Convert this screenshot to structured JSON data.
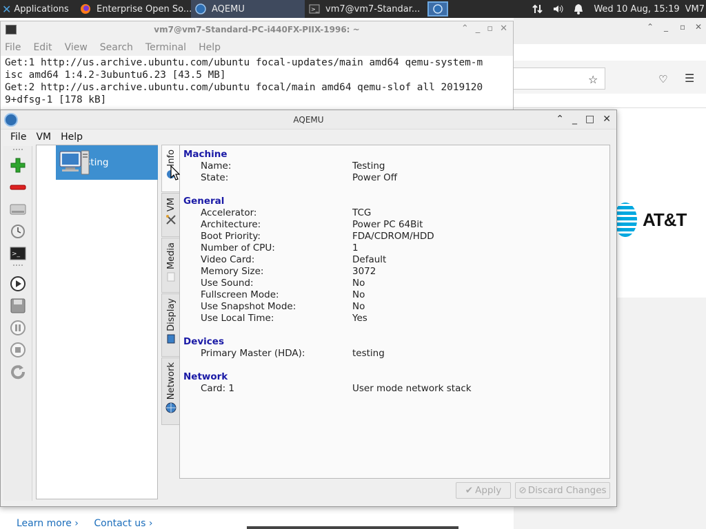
{
  "taskbar": {
    "applications": "Applications",
    "tasks": [
      {
        "label": "Enterprise Open So..."
      },
      {
        "label": "AQEMU"
      },
      {
        "label": "vm7@vm7-Standar..."
      }
    ],
    "clock": "Wed 10 Aug, 15:19",
    "user": "VM7"
  },
  "terminal": {
    "title": "vm7@vm7-Standard-PC-i440FX-PIIX-1996: ~",
    "menu": [
      "File",
      "Edit",
      "View",
      "Search",
      "Terminal",
      "Help"
    ],
    "lines": [
      "Get:1 http://us.archive.ubuntu.com/ubuntu focal-updates/main amd64 qemu-system-m",
      "isc amd64 1:4.2-3ubuntu6.23 [43.5 MB]",
      "Get:2 http://us.archive.ubuntu.com/ubuntu focal/main amd64 qemu-slof all 2019120",
      "9+dfsg-1 [178 kB]"
    ]
  },
  "browser": {
    "brand": "AT&T",
    "links": [
      "Learn more ›",
      "Contact us ›"
    ]
  },
  "aqemu": {
    "title": "AQEMU",
    "menu": [
      "File",
      "VM",
      "Help"
    ],
    "vm_name": "Testing",
    "tabs": [
      "Info",
      "VM",
      "Media",
      "Display",
      "Network"
    ],
    "sections": {
      "machine": {
        "heading": "Machine",
        "rows": [
          {
            "k": "Name:",
            "v": "Testing"
          },
          {
            "k": "State:",
            "v": "Power Off"
          }
        ]
      },
      "general": {
        "heading": "General",
        "rows": [
          {
            "k": "Accelerator:",
            "v": "TCG"
          },
          {
            "k": "Architecture:",
            "v": "Power PC 64Bit"
          },
          {
            "k": "Boot Priority:",
            "v": "FDA/CDROM/HDD"
          },
          {
            "k": "Number of CPU:",
            "v": "1"
          },
          {
            "k": "Video Card:",
            "v": "Default"
          },
          {
            "k": "Memory Size:",
            "v": "3072"
          },
          {
            "k": "Use Sound:",
            "v": "No"
          },
          {
            "k": "Fullscreen Mode:",
            "v": "No"
          },
          {
            "k": "Use Snapshot Mode:",
            "v": "No"
          },
          {
            "k": "Use Local Time:",
            "v": "Yes"
          }
        ]
      },
      "devices": {
        "heading": "Devices",
        "rows": [
          {
            "k": "Primary Master (HDA):",
            "v": "testing"
          }
        ]
      },
      "network": {
        "heading": "Network",
        "rows": [
          {
            "k": "Card: 1",
            "v": "User mode network stack"
          }
        ]
      }
    },
    "buttons": {
      "apply": "Apply",
      "discard": "Discard Changes"
    }
  },
  "colors": {
    "section_heading": "#1a1aa6",
    "selection": "#3d8fd0",
    "panel_bg": "#2b2b2b"
  }
}
